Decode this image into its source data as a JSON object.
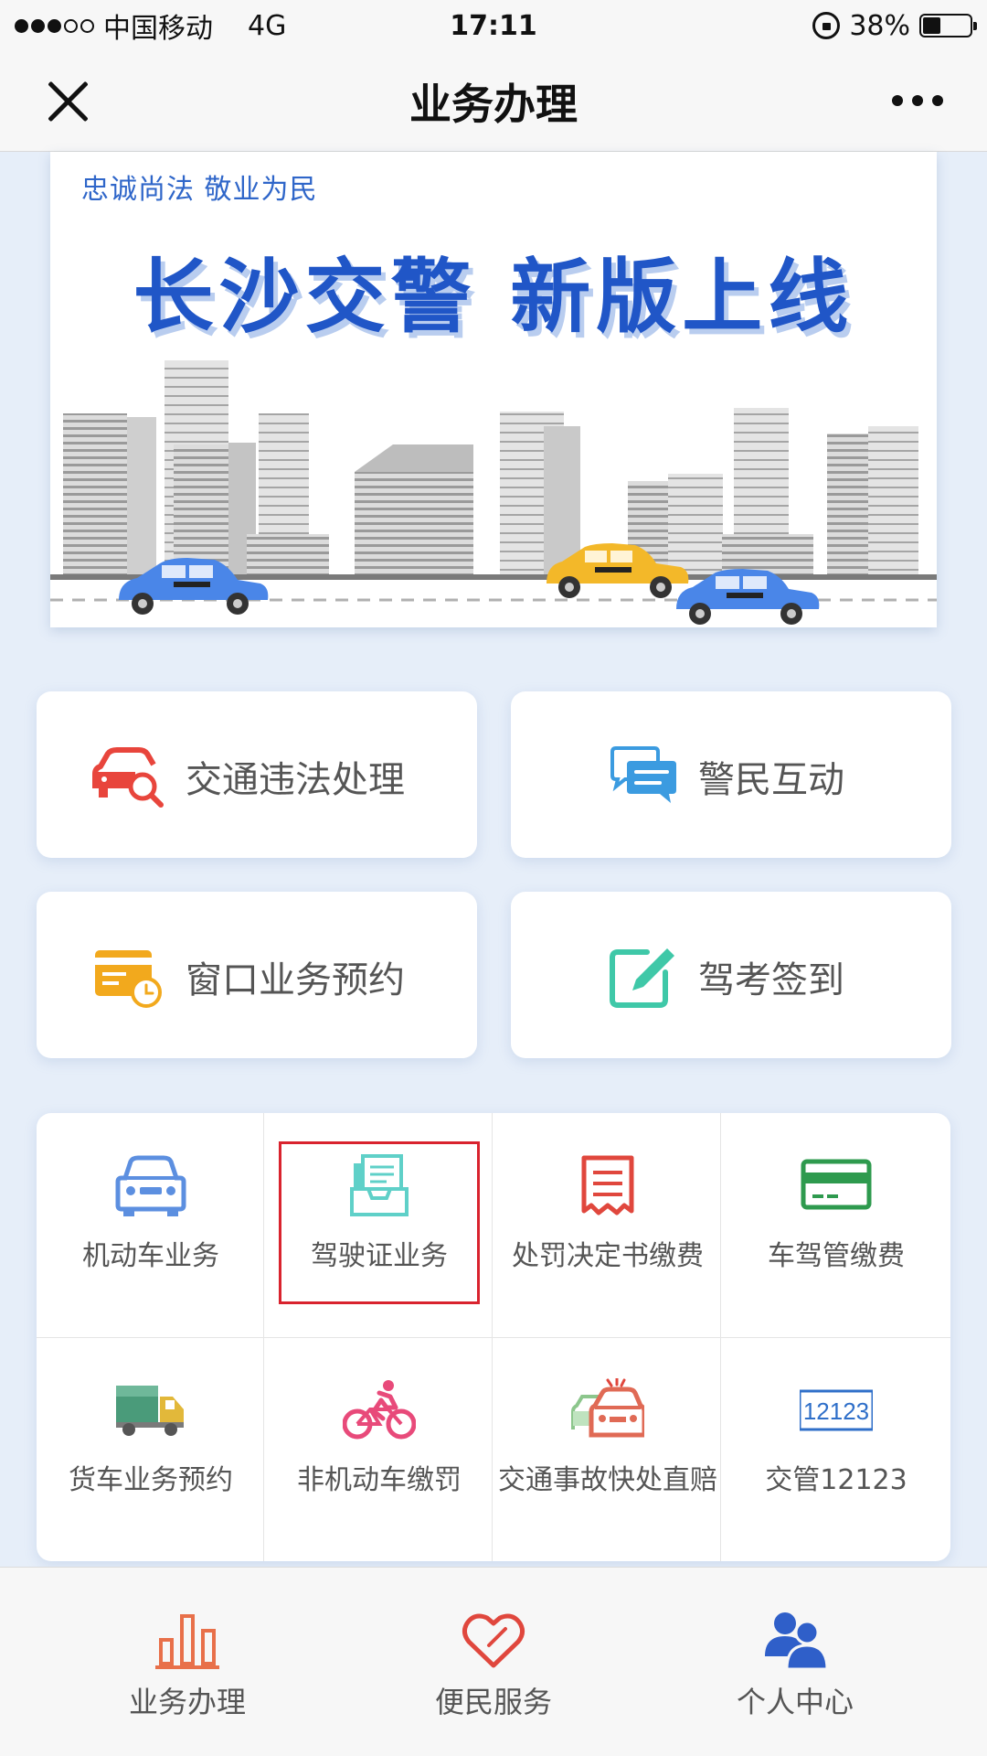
{
  "status_bar": {
    "carrier": "中国移动",
    "network": "4G",
    "time": "17:11",
    "battery": "38%",
    "battery_level": 0.38
  },
  "nav": {
    "title": "业务办理",
    "close_icon": "close-icon",
    "more_icon": "more-icon"
  },
  "banner": {
    "slogan": "忠诚尚法  敬业为民",
    "headline": "长沙交警  新版上线"
  },
  "cards": [
    {
      "label": "交通违法处理",
      "icon": "car-search-icon",
      "color": "#e8453c"
    },
    {
      "label": "警民互动",
      "icon": "chat-bubbles-icon",
      "color": "#3b9be0"
    },
    {
      "label": "窗口业务预约",
      "icon": "appointment-card-icon",
      "color": "#f2a91d"
    },
    {
      "label": "驾考签到",
      "icon": "edit-icon",
      "color": "#3fc8a8"
    }
  ],
  "services": [
    {
      "label": "机动车业务",
      "icon": "car-icon",
      "color": "#5c8fe0"
    },
    {
      "label": "驾驶证业务",
      "icon": "license-doc-icon",
      "color": "#5fd0c8"
    },
    {
      "label": "处罚决定书缴费",
      "icon": "receipt-icon",
      "color": "#e0473d"
    },
    {
      "label": "车驾管缴费",
      "icon": "bank-card-icon",
      "color": "#2e9a4e"
    },
    {
      "label": "货车业务预约",
      "icon": "truck-icon",
      "color": "#4a9b7a"
    },
    {
      "label": "非机动车缴罚",
      "icon": "bicycle-icon",
      "color": "#e84a7a"
    },
    {
      "label": "交通事故快处直赔",
      "icon": "car-crash-icon",
      "color": "#e06a55"
    },
    {
      "label": "交管12123",
      "icon": "badge-12123-icon",
      "color": "#2f6fc9",
      "badge_text": "12123"
    }
  ],
  "tabs": [
    {
      "label": "业务办理",
      "icon": "bar-chart-icon",
      "color": "#e8704a"
    },
    {
      "label": "便民服务",
      "icon": "heart-tag-icon",
      "color": "#e0473d"
    },
    {
      "label": "个人中心",
      "icon": "users-icon",
      "color": "#2f5fc9"
    }
  ]
}
